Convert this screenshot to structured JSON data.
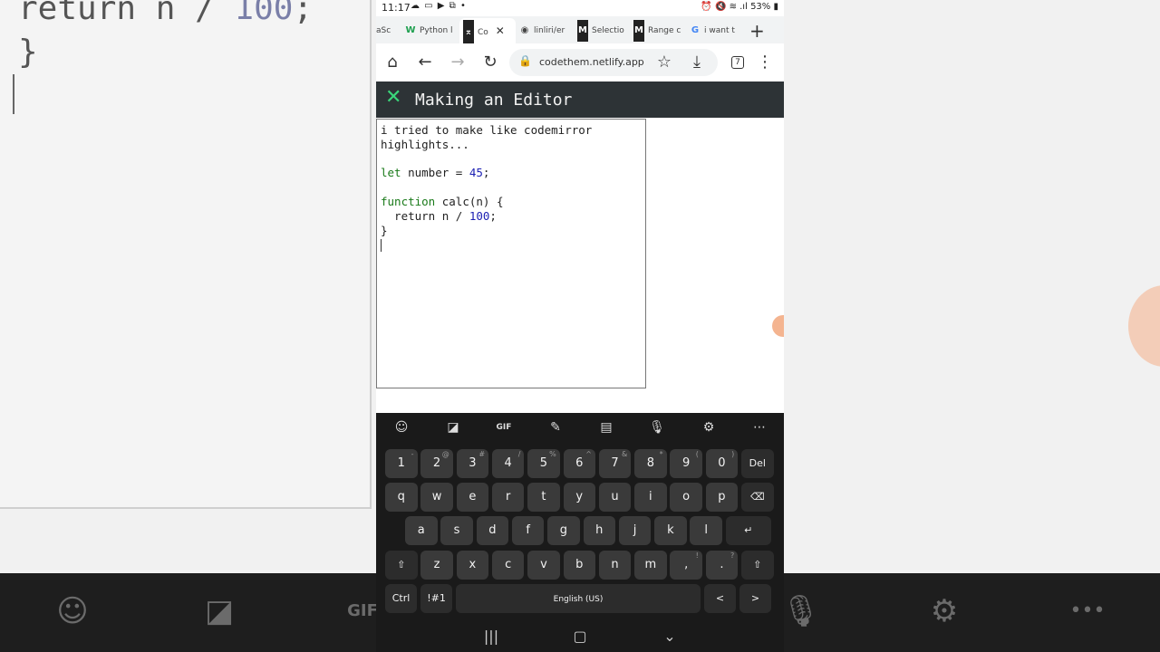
{
  "status_bar": {
    "time": "11:17",
    "left_icons": "☁ ▭ ▶ ⧉ •",
    "battery": "53%",
    "right_icons": "⏰ 🔇 ≋ .ıl"
  },
  "browser": {
    "tabs": [
      {
        "icon": "",
        "label": "aSc",
        "active": false
      },
      {
        "icon": "W",
        "label": "Python l",
        "active": false
      },
      {
        "icon": "⌅",
        "label": "Co",
        "active": true
      },
      {
        "icon": "◉",
        "label": "linliri/er",
        "active": false
      },
      {
        "icon": "M",
        "label": "Selectio",
        "active": false
      },
      {
        "icon": "M",
        "label": "Range c",
        "active": false
      },
      {
        "icon": "G",
        "label": "i want t",
        "active": false
      }
    ],
    "url": "codethem.netlify.app",
    "tab_count": "7"
  },
  "page": {
    "title": "Making an Editor",
    "editor_lines": [
      [
        {
          "t": "i tried to make like codemirror",
          "c": "txt"
        }
      ],
      [
        {
          "t": "highlights...",
          "c": "txt"
        }
      ],
      [
        {
          "t": "",
          "c": "txt"
        }
      ],
      [
        {
          "t": "let",
          "c": "kw"
        },
        {
          "t": " number = ",
          "c": "txt"
        },
        {
          "t": "45",
          "c": "nm"
        },
        {
          "t": ";",
          "c": "txt"
        }
      ],
      [
        {
          "t": "",
          "c": "txt"
        }
      ],
      [
        {
          "t": "function",
          "c": "kw"
        },
        {
          "t": " calc(n) {",
          "c": "txt"
        }
      ],
      [
        {
          "t": "  return n / ",
          "c": "txt"
        },
        {
          "t": "100",
          "c": "nm"
        },
        {
          "t": ";",
          "c": "txt"
        }
      ],
      [
        {
          "t": "}",
          "c": "txt"
        }
      ]
    ]
  },
  "background": {
    "code_line_1_a": "return n / ",
    "code_line_1_b": "100",
    "code_line_1_c": ";",
    "code_line_2": "}"
  },
  "keyboard": {
    "toolbar": [
      "emoji-icon",
      "sticker-icon",
      "gif-icon",
      "handwriting-icon",
      "clipboard-icon",
      "mic-icon",
      "settings-icon",
      "more-icon"
    ],
    "rows": [
      [
        [
          "1",
          "-"
        ],
        [
          "2",
          "@"
        ],
        [
          "3",
          "#"
        ],
        [
          "4",
          "/"
        ],
        [
          "5",
          "%"
        ],
        [
          "6",
          "^"
        ],
        [
          "7",
          "&"
        ],
        [
          "8",
          "*"
        ],
        [
          "9",
          "("
        ],
        [
          "0",
          ")"
        ],
        [
          "Del",
          ""
        ]
      ],
      [
        [
          "q",
          ""
        ],
        [
          "w",
          ""
        ],
        [
          "e",
          ""
        ],
        [
          "r",
          ""
        ],
        [
          "t",
          ""
        ],
        [
          "y",
          ""
        ],
        [
          "u",
          ""
        ],
        [
          "i",
          ""
        ],
        [
          "o",
          ""
        ],
        [
          "p",
          ""
        ],
        [
          "⌫",
          ""
        ]
      ],
      [
        [
          "a",
          ""
        ],
        [
          "s",
          ""
        ],
        [
          "d",
          ""
        ],
        [
          "f",
          ""
        ],
        [
          "g",
          ""
        ],
        [
          "h",
          ""
        ],
        [
          "j",
          ""
        ],
        [
          "k",
          ""
        ],
        [
          "l",
          ""
        ],
        [
          "↵",
          ""
        ]
      ],
      [
        [
          "⇧",
          ""
        ],
        [
          "z",
          ""
        ],
        [
          "x",
          ""
        ],
        [
          "c",
          ""
        ],
        [
          "v",
          ""
        ],
        [
          "b",
          ""
        ],
        [
          "n",
          ""
        ],
        [
          "m",
          ""
        ],
        [
          ",",
          "!"
        ],
        [
          ".",
          "?"
        ],
        [
          "⇧",
          ""
        ]
      ],
      [
        [
          "Ctrl",
          ""
        ],
        [
          "!#1",
          ""
        ],
        [
          "English (US)",
          ""
        ],
        [
          "<",
          ""
        ],
        [
          ">",
          ""
        ]
      ]
    ]
  }
}
